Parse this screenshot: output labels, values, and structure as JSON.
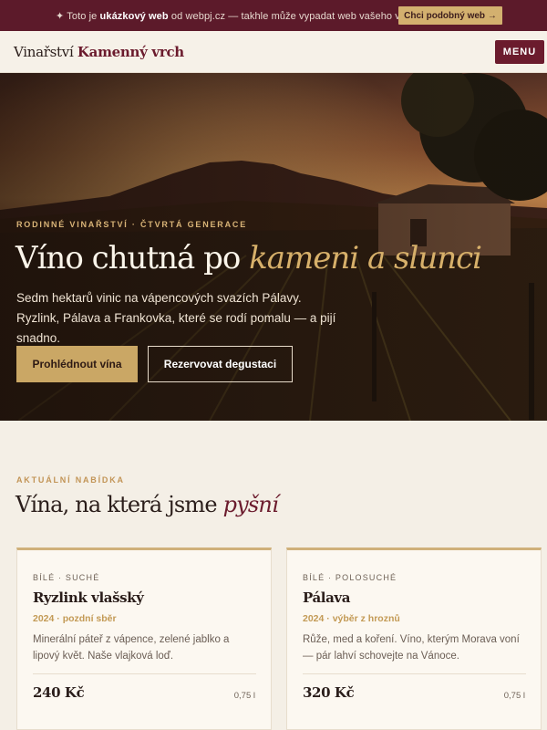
{
  "promo": {
    "prefix": "✦ Toto je ",
    "bold": "ukázkový web",
    "suffix": " od webpj.cz — takhle může vypadat web vašeho vinařství.",
    "button_label": "Chci podobný web →"
  },
  "header": {
    "logo_prefix": "Vinařství ",
    "logo_brand": "Kamenný vrch",
    "menu_label": "MENU"
  },
  "hero": {
    "eyebrow": "RODINNÉ VINAŘSTVÍ · ČTVRTÁ GENERACE",
    "title_main": "Víno chutná po ",
    "title_accent": "kameni a slunci",
    "lead": "Sedm hektarů vinic na vápencových svazích Pálavy. Ryzlink, Pálava a Frankovka, které se rodí pomalu — a pijí snadno.",
    "primary_button": "Prohlédnout vína",
    "secondary_button": "Rezervovat degustaci"
  },
  "offer": {
    "eyebrow": "AKTUÁLNÍ NABÍDKA",
    "title_main": "Vína, na která jsme ",
    "title_accent": "pyšní"
  },
  "wines": [
    {
      "tag": "BÍLÉ · SUCHÉ",
      "name": "Ryzlink vlašský",
      "year": "2024 · pozdní sběr",
      "description": "Minerální páteř z vápence, zelené jablko a lipový květ. Naše vlajková loď.",
      "price": "240 Kč",
      "volume": "0,75 l"
    },
    {
      "tag": "BÍLÉ · POLOSUCHÉ",
      "name": "Pálava",
      "year": "2024 · výběr z hroznů",
      "description": "Růže, med a koření. Víno, kterým Morava voní — pár lahví schovejte na Vánoce.",
      "price": "320 Kč",
      "volume": "0,75 l"
    }
  ],
  "colors": {
    "wine": "#6b1b2d",
    "gold": "#caa765",
    "cream": "#f4efe6"
  }
}
